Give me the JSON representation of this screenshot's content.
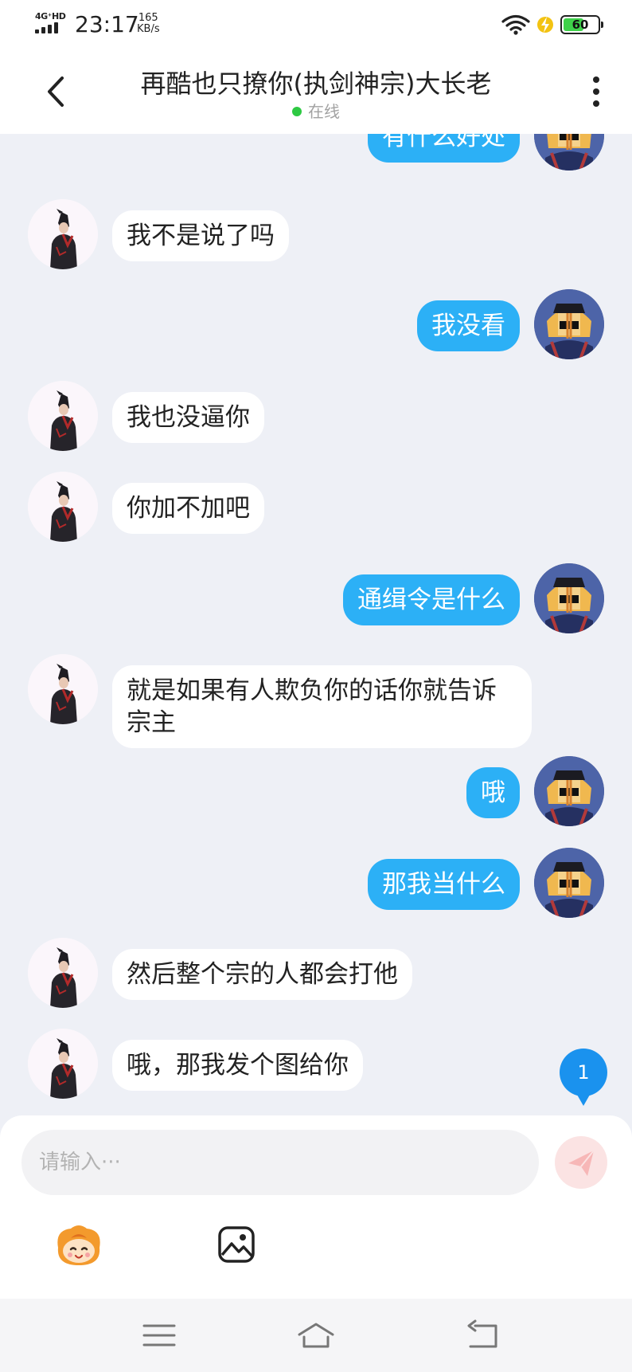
{
  "status_bar": {
    "network": "4G⁺HD",
    "time": "23:17",
    "speed_value": "165",
    "speed_unit": "KB/s",
    "battery": "60"
  },
  "header": {
    "title": "再酷也只撩你(执剑神宗)大长老",
    "presence": "在线"
  },
  "messages": [
    {
      "side": "right",
      "text": "有什么好处"
    },
    {
      "side": "left",
      "text": "我不是说了吗"
    },
    {
      "side": "right",
      "text": "我没看"
    },
    {
      "side": "left",
      "text": "我也没逼你"
    },
    {
      "side": "left",
      "text": "你加不加吧"
    },
    {
      "side": "right",
      "text": "通缉令是什么"
    },
    {
      "side": "left",
      "text": "就是如果有人欺负你的话你就告诉宗主"
    },
    {
      "side": "right",
      "text": "哦"
    },
    {
      "side": "right",
      "text": "那我当什么"
    },
    {
      "side": "left",
      "text": "然后整个宗的人都会打他"
    },
    {
      "side": "left",
      "text": "哦，那我发个图给你"
    }
  ],
  "unread_count": "1",
  "composer": {
    "placeholder": "请输入···",
    "value": ""
  },
  "icons": {
    "back": "chevron-left-icon",
    "more": "more-vertical-icon",
    "send": "paper-plane-icon",
    "emoji": "mascot-emoji-icon",
    "image": "image-gallery-icon",
    "nav_menu": "menu-icon",
    "nav_home": "home-icon",
    "nav_back": "return-icon"
  },
  "colors": {
    "accent_bubble": "#2cb0f6",
    "chat_background": "#eef0f6",
    "online_dot": "#2ec943",
    "badge": "#1a92ee"
  }
}
